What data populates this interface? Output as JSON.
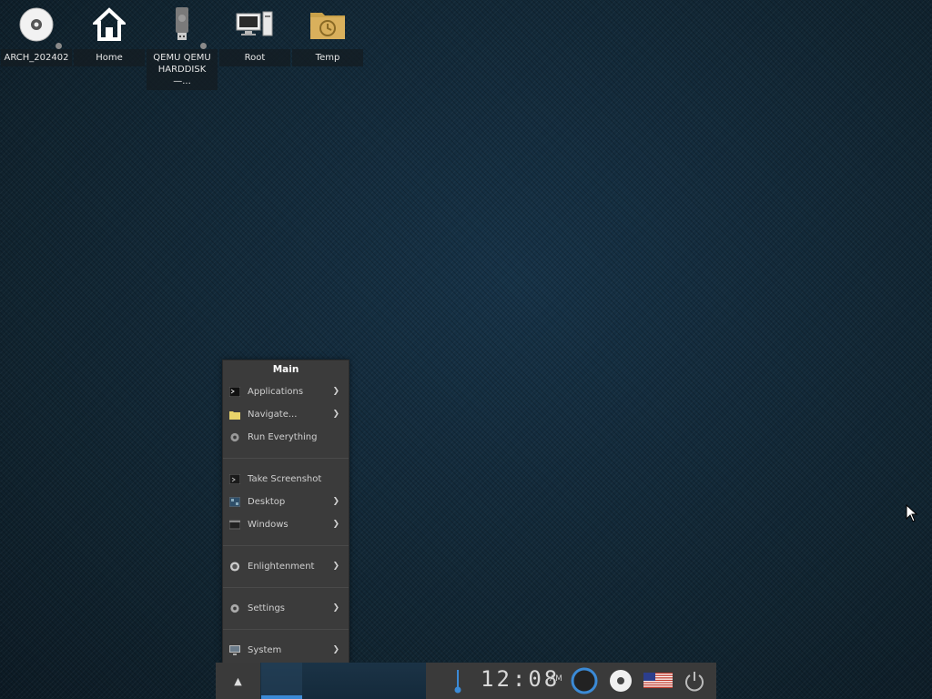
{
  "desktop": {
    "icons": [
      {
        "label": "ARCH_202402",
        "icon": "cd-icon"
      },
      {
        "label": "Home",
        "icon": "home-icon"
      },
      {
        "label": "QEMU QEMU HARDDISK—...",
        "icon": "usb-drive-icon"
      },
      {
        "label": "Root",
        "icon": "computer-icon"
      },
      {
        "label": "Temp",
        "icon": "folder-clock-icon"
      }
    ]
  },
  "menu": {
    "title": "Main",
    "items": [
      {
        "label": "Applications",
        "icon": "terminal-icon"
      },
      {
        "label": "Navigate...",
        "icon": "folder-icon"
      },
      {
        "label": "Run Everything",
        "icon": "gear-icon"
      },
      {
        "label": "Take Screenshot",
        "icon": "screenshot-icon"
      },
      {
        "label": "Desktop",
        "icon": "desktop-icon"
      },
      {
        "label": "Windows",
        "icon": "windows-icon"
      },
      {
        "label": "Enlightenment",
        "icon": "enlightenment-icon"
      },
      {
        "label": "Settings",
        "icon": "settings-icon"
      },
      {
        "label": "System",
        "icon": "monitor-icon"
      }
    ]
  },
  "shelf": {
    "start_glyph": "▲",
    "clock": "12:08",
    "ampm": "AM",
    "accent": "#3b8ad6"
  }
}
